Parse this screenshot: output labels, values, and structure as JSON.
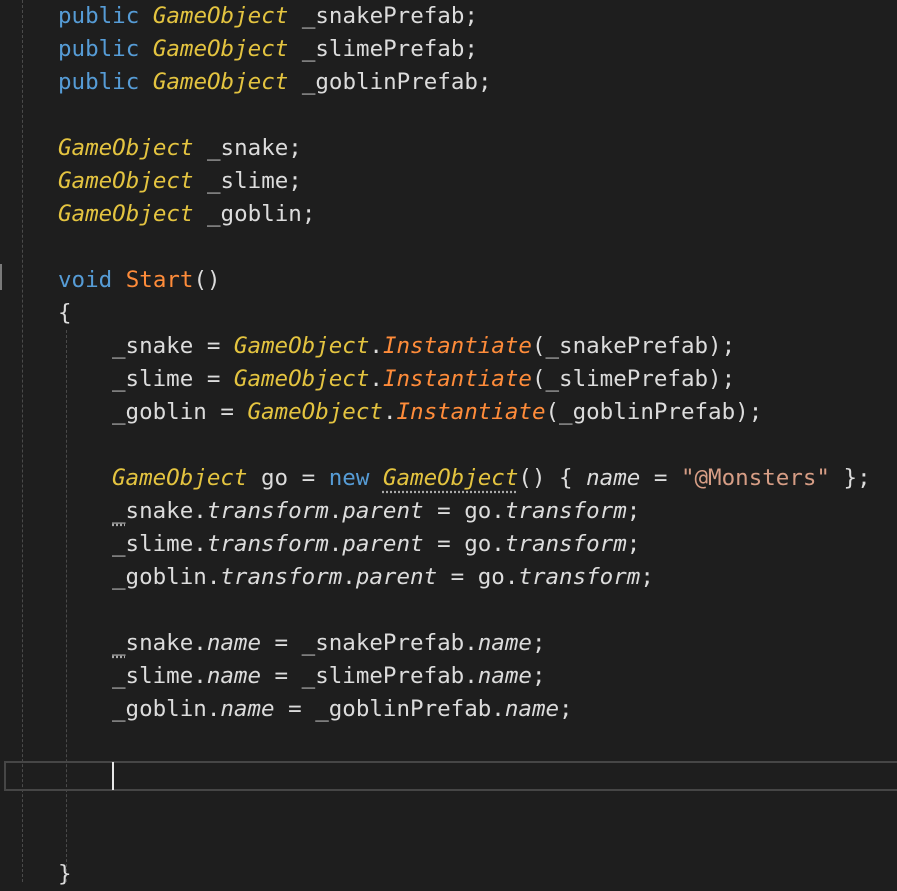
{
  "editor": {
    "lines": [
      {
        "id": "l1",
        "tokens": [
          {
            "t": "public",
            "c": "kw"
          },
          {
            "t": " ",
            "c": "txt"
          },
          {
            "t": "GameObject",
            "c": "ty"
          },
          {
            "t": " _snakePrefab;",
            "c": "txt"
          }
        ]
      },
      {
        "id": "l2",
        "tokens": [
          {
            "t": "public",
            "c": "kw"
          },
          {
            "t": " ",
            "c": "txt"
          },
          {
            "t": "GameObject",
            "c": "ty"
          },
          {
            "t": " _slimePrefab;",
            "c": "txt"
          }
        ]
      },
      {
        "id": "l3",
        "tokens": [
          {
            "t": "public",
            "c": "kw"
          },
          {
            "t": " ",
            "c": "txt"
          },
          {
            "t": "GameObject",
            "c": "ty"
          },
          {
            "t": " _goblinPrefab;",
            "c": "txt"
          }
        ]
      },
      {
        "id": "l4",
        "tokens": []
      },
      {
        "id": "l5",
        "tokens": [
          {
            "t": "GameObject",
            "c": "ty"
          },
          {
            "t": " _snake;",
            "c": "txt"
          }
        ]
      },
      {
        "id": "l6",
        "tokens": [
          {
            "t": "GameObject",
            "c": "ty"
          },
          {
            "t": " _slime;",
            "c": "txt"
          }
        ]
      },
      {
        "id": "l7",
        "tokens": [
          {
            "t": "GameObject",
            "c": "ty"
          },
          {
            "t": " _goblin;",
            "c": "txt"
          }
        ]
      },
      {
        "id": "l8",
        "tokens": []
      },
      {
        "id": "l9",
        "tokens": [
          {
            "t": "void",
            "c": "kw"
          },
          {
            "t": " ",
            "c": "txt"
          },
          {
            "t": "Start",
            "c": "fn"
          },
          {
            "t": "()",
            "c": "txt"
          }
        ]
      },
      {
        "id": "l10",
        "tokens": [
          {
            "t": "{",
            "c": "txt"
          }
        ]
      },
      {
        "id": "l11",
        "tokens": [
          {
            "t": "_snake = ",
            "c": "txt"
          },
          {
            "t": "GameObject",
            "c": "ty"
          },
          {
            "t": ".",
            "c": "txt"
          },
          {
            "t": "Instantiate",
            "c": "fn-it"
          },
          {
            "t": "(_snakePrefab);",
            "c": "txt"
          }
        ]
      },
      {
        "id": "l12",
        "tokens": [
          {
            "t": "_slime = ",
            "c": "txt"
          },
          {
            "t": "GameObject",
            "c": "ty"
          },
          {
            "t": ".",
            "c": "txt"
          },
          {
            "t": "Instantiate",
            "c": "fn-it"
          },
          {
            "t": "(_slimePrefab);",
            "c": "txt"
          }
        ]
      },
      {
        "id": "l13",
        "tokens": [
          {
            "t": "_goblin = ",
            "c": "txt"
          },
          {
            "t": "GameObject",
            "c": "ty"
          },
          {
            "t": ".",
            "c": "txt"
          },
          {
            "t": "Instantiate",
            "c": "fn-it"
          },
          {
            "t": "(_goblinPrefab);",
            "c": "txt"
          }
        ]
      },
      {
        "id": "l14",
        "tokens": []
      },
      {
        "id": "l15",
        "tokens": [
          {
            "t": "GameObject",
            "c": "ty"
          },
          {
            "t": " go = ",
            "c": "txt"
          },
          {
            "t": "new",
            "c": "kw"
          },
          {
            "t": " ",
            "c": "txt"
          },
          {
            "t": "GameObject",
            "c": "ty squig"
          },
          {
            "t": "() { ",
            "c": "txt"
          },
          {
            "t": "name",
            "c": "prop"
          },
          {
            "t": " = ",
            "c": "txt"
          },
          {
            "t": "\"@Monsters\"",
            "c": "str"
          },
          {
            "t": " };",
            "c": "txt"
          }
        ]
      },
      {
        "id": "l16",
        "tokens": [
          {
            "t": "_",
            "c": "txt squig"
          },
          {
            "t": "snake.",
            "c": "txt"
          },
          {
            "t": "transform",
            "c": "prop"
          },
          {
            "t": ".",
            "c": "txt"
          },
          {
            "t": "parent",
            "c": "prop"
          },
          {
            "t": " = go.",
            "c": "txt"
          },
          {
            "t": "transform",
            "c": "prop"
          },
          {
            "t": ";",
            "c": "txt"
          }
        ]
      },
      {
        "id": "l17",
        "tokens": [
          {
            "t": "_slime.",
            "c": "txt"
          },
          {
            "t": "transform",
            "c": "prop"
          },
          {
            "t": ".",
            "c": "txt"
          },
          {
            "t": "parent",
            "c": "prop"
          },
          {
            "t": " = go.",
            "c": "txt"
          },
          {
            "t": "transform",
            "c": "prop"
          },
          {
            "t": ";",
            "c": "txt"
          }
        ]
      },
      {
        "id": "l18",
        "tokens": [
          {
            "t": "_goblin.",
            "c": "txt"
          },
          {
            "t": "transform",
            "c": "prop"
          },
          {
            "t": ".",
            "c": "txt"
          },
          {
            "t": "parent",
            "c": "prop"
          },
          {
            "t": " = go.",
            "c": "txt"
          },
          {
            "t": "transform",
            "c": "prop"
          },
          {
            "t": ";",
            "c": "txt"
          }
        ]
      },
      {
        "id": "l19",
        "tokens": []
      },
      {
        "id": "l20",
        "tokens": [
          {
            "t": "_",
            "c": "txt squig"
          },
          {
            "t": "snake.",
            "c": "txt"
          },
          {
            "t": "name",
            "c": "prop"
          },
          {
            "t": " = _snakePrefab.",
            "c": "txt"
          },
          {
            "t": "name",
            "c": "prop"
          },
          {
            "t": ";",
            "c": "txt"
          }
        ]
      },
      {
        "id": "l21",
        "tokens": [
          {
            "t": "_slime.",
            "c": "txt"
          },
          {
            "t": "name",
            "c": "prop"
          },
          {
            "t": " = _slimePrefab.",
            "c": "txt"
          },
          {
            "t": "name",
            "c": "prop"
          },
          {
            "t": ";",
            "c": "txt"
          }
        ]
      },
      {
        "id": "l22",
        "tokens": [
          {
            "t": "_goblin.",
            "c": "txt"
          },
          {
            "t": "name",
            "c": "prop"
          },
          {
            "t": " = _goblinPrefab.",
            "c": "txt"
          },
          {
            "t": "name",
            "c": "prop"
          },
          {
            "t": ";",
            "c": "txt"
          }
        ]
      },
      {
        "id": "l23",
        "tokens": []
      },
      {
        "id": "l24",
        "tokens": []
      },
      {
        "id": "l25",
        "tokens": []
      },
      {
        "id": "l26",
        "tokens": []
      },
      {
        "id": "l27",
        "tokens": [
          {
            "t": "}",
            "c": "txt"
          }
        ]
      }
    ]
  },
  "colors": {
    "background": "#1e1e1e",
    "keyword": "#569cd6",
    "type": "#e4c440",
    "method": "#ff8c3a",
    "string": "#d69d85",
    "text": "#dcdcdc"
  }
}
